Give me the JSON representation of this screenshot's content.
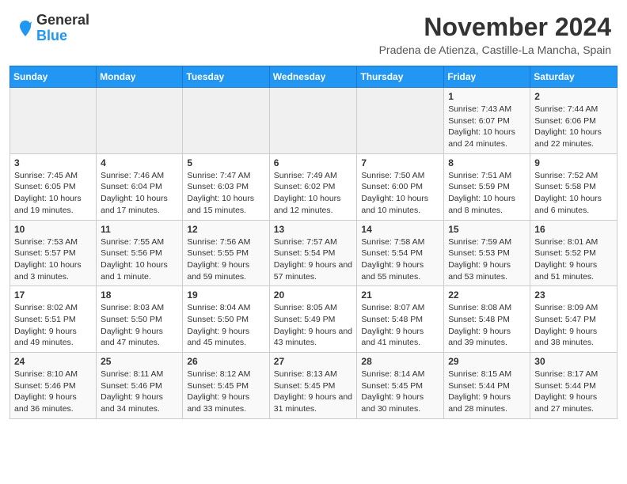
{
  "logo": {
    "general": "General",
    "blue": "Blue"
  },
  "header": {
    "title": "November 2024",
    "subtitle": "Pradena de Atienza, Castille-La Mancha, Spain"
  },
  "weekdays": [
    "Sunday",
    "Monday",
    "Tuesday",
    "Wednesday",
    "Thursday",
    "Friday",
    "Saturday"
  ],
  "weeks": [
    [
      {
        "day": "",
        "info": ""
      },
      {
        "day": "",
        "info": ""
      },
      {
        "day": "",
        "info": ""
      },
      {
        "day": "",
        "info": ""
      },
      {
        "day": "",
        "info": ""
      },
      {
        "day": "1",
        "info": "Sunrise: 7:43 AM\nSunset: 6:07 PM\nDaylight: 10 hours and 24 minutes."
      },
      {
        "day": "2",
        "info": "Sunrise: 7:44 AM\nSunset: 6:06 PM\nDaylight: 10 hours and 22 minutes."
      }
    ],
    [
      {
        "day": "3",
        "info": "Sunrise: 7:45 AM\nSunset: 6:05 PM\nDaylight: 10 hours and 19 minutes."
      },
      {
        "day": "4",
        "info": "Sunrise: 7:46 AM\nSunset: 6:04 PM\nDaylight: 10 hours and 17 minutes."
      },
      {
        "day": "5",
        "info": "Sunrise: 7:47 AM\nSunset: 6:03 PM\nDaylight: 10 hours and 15 minutes."
      },
      {
        "day": "6",
        "info": "Sunrise: 7:49 AM\nSunset: 6:02 PM\nDaylight: 10 hours and 12 minutes."
      },
      {
        "day": "7",
        "info": "Sunrise: 7:50 AM\nSunset: 6:00 PM\nDaylight: 10 hours and 10 minutes."
      },
      {
        "day": "8",
        "info": "Sunrise: 7:51 AM\nSunset: 5:59 PM\nDaylight: 10 hours and 8 minutes."
      },
      {
        "day": "9",
        "info": "Sunrise: 7:52 AM\nSunset: 5:58 PM\nDaylight: 10 hours and 6 minutes."
      }
    ],
    [
      {
        "day": "10",
        "info": "Sunrise: 7:53 AM\nSunset: 5:57 PM\nDaylight: 10 hours and 3 minutes."
      },
      {
        "day": "11",
        "info": "Sunrise: 7:55 AM\nSunset: 5:56 PM\nDaylight: 10 hours and 1 minute."
      },
      {
        "day": "12",
        "info": "Sunrise: 7:56 AM\nSunset: 5:55 PM\nDaylight: 9 hours and 59 minutes."
      },
      {
        "day": "13",
        "info": "Sunrise: 7:57 AM\nSunset: 5:54 PM\nDaylight: 9 hours and 57 minutes."
      },
      {
        "day": "14",
        "info": "Sunrise: 7:58 AM\nSunset: 5:54 PM\nDaylight: 9 hours and 55 minutes."
      },
      {
        "day": "15",
        "info": "Sunrise: 7:59 AM\nSunset: 5:53 PM\nDaylight: 9 hours and 53 minutes."
      },
      {
        "day": "16",
        "info": "Sunrise: 8:01 AM\nSunset: 5:52 PM\nDaylight: 9 hours and 51 minutes."
      }
    ],
    [
      {
        "day": "17",
        "info": "Sunrise: 8:02 AM\nSunset: 5:51 PM\nDaylight: 9 hours and 49 minutes."
      },
      {
        "day": "18",
        "info": "Sunrise: 8:03 AM\nSunset: 5:50 PM\nDaylight: 9 hours and 47 minutes."
      },
      {
        "day": "19",
        "info": "Sunrise: 8:04 AM\nSunset: 5:50 PM\nDaylight: 9 hours and 45 minutes."
      },
      {
        "day": "20",
        "info": "Sunrise: 8:05 AM\nSunset: 5:49 PM\nDaylight: 9 hours and 43 minutes."
      },
      {
        "day": "21",
        "info": "Sunrise: 8:07 AM\nSunset: 5:48 PM\nDaylight: 9 hours and 41 minutes."
      },
      {
        "day": "22",
        "info": "Sunrise: 8:08 AM\nSunset: 5:48 PM\nDaylight: 9 hours and 39 minutes."
      },
      {
        "day": "23",
        "info": "Sunrise: 8:09 AM\nSunset: 5:47 PM\nDaylight: 9 hours and 38 minutes."
      }
    ],
    [
      {
        "day": "24",
        "info": "Sunrise: 8:10 AM\nSunset: 5:46 PM\nDaylight: 9 hours and 36 minutes."
      },
      {
        "day": "25",
        "info": "Sunrise: 8:11 AM\nSunset: 5:46 PM\nDaylight: 9 hours and 34 minutes."
      },
      {
        "day": "26",
        "info": "Sunrise: 8:12 AM\nSunset: 5:45 PM\nDaylight: 9 hours and 33 minutes."
      },
      {
        "day": "27",
        "info": "Sunrise: 8:13 AM\nSunset: 5:45 PM\nDaylight: 9 hours and 31 minutes."
      },
      {
        "day": "28",
        "info": "Sunrise: 8:14 AM\nSunset: 5:45 PM\nDaylight: 9 hours and 30 minutes."
      },
      {
        "day": "29",
        "info": "Sunrise: 8:15 AM\nSunset: 5:44 PM\nDaylight: 9 hours and 28 minutes."
      },
      {
        "day": "30",
        "info": "Sunrise: 8:17 AM\nSunset: 5:44 PM\nDaylight: 9 hours and 27 minutes."
      }
    ]
  ]
}
